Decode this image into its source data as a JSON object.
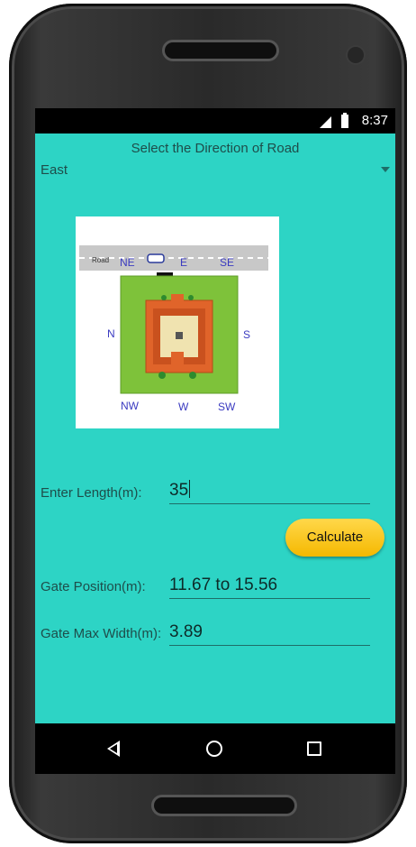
{
  "status_bar": {
    "time": "8:37"
  },
  "header": {
    "title": "Select the Direction of Road"
  },
  "direction_select": {
    "selected": "East"
  },
  "diagram": {
    "road_label": "Road",
    "labels": {
      "ne": "NE",
      "e": "E",
      "se": "SE",
      "n": "N",
      "s": "S",
      "nw": "NW",
      "w": "W",
      "sw": "SW"
    },
    "colors": {
      "road": "#c8c8c8",
      "plot": "#7ec23a",
      "house": "#e0642a",
      "court": "#f0e3b0"
    }
  },
  "form": {
    "length_label": "Enter Length(m):",
    "length_value": "35",
    "calculate_label": "Calculate",
    "gate_position_label": "Gate Position(m):",
    "gate_position_value": "11.67 to 15.56",
    "gate_width_label": "Gate Max Width(m):",
    "gate_width_value": "3.89"
  },
  "colors": {
    "screen_bg": "#2dd4c5",
    "button": "#f5b800"
  }
}
